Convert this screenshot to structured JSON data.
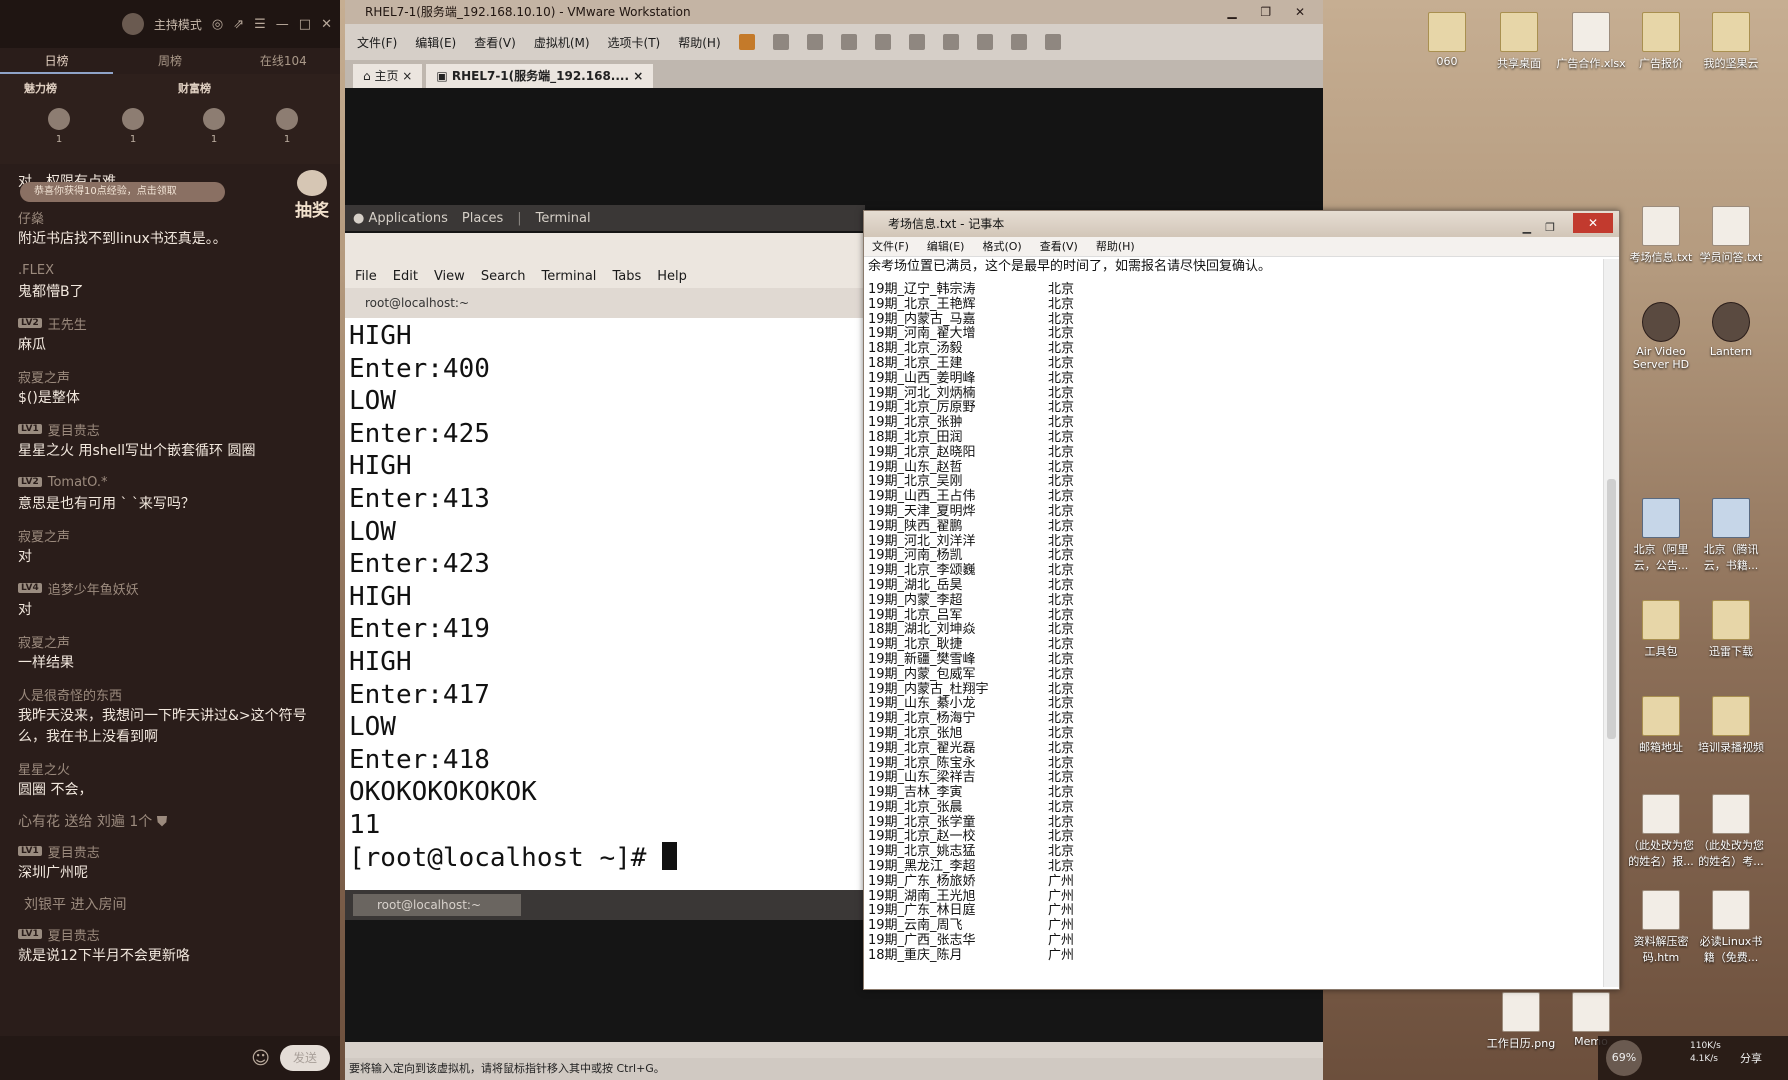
{
  "chat": {
    "mode_label": "主持模式",
    "tabs": [
      "日榜",
      "周榜",
      "在线104"
    ],
    "rank_titles": [
      "魅力榜",
      "财富榜"
    ],
    "rank_counts": [
      "1",
      "1",
      "1",
      "1"
    ],
    "pill_text": "恭喜你获得10点经验，点击领取",
    "lottery_label": "抽奖",
    "messages": [
      {
        "user": "",
        "lv": "",
        "text": "对，权限有点难"
      },
      {
        "user": "仔燊",
        "lv": "",
        "text": "附近书店找不到linux书还真是。。"
      },
      {
        "user": ".FLEX",
        "lv": "",
        "text": "鬼都懵B了"
      },
      {
        "user": "王先生",
        "lv": "LV2",
        "text": "麻瓜"
      },
      {
        "user": "寂夏之声",
        "lv": "",
        "text": "$()是整体"
      },
      {
        "user": "夏目贵志",
        "lv": "LV1",
        "text": "星星之火 用shell写出个嵌套循环 圆圈"
      },
      {
        "user": "TomatO.*",
        "lv": "LV2",
        "text": "意思是也有可用 ` `来写吗？"
      },
      {
        "user": "寂夏之声",
        "lv": "",
        "text": "对"
      },
      {
        "user": "追梦少年鱼妖妖",
        "lv": "LV4",
        "text": "对"
      },
      {
        "user": "寂夏之声",
        "lv": "",
        "text": "一样结果"
      },
      {
        "user": "人是很奇怪的东西",
        "lv": "",
        "text": "我昨天没来，我想问一下昨天讲过&>这个符号么，我在书上没看到啊"
      },
      {
        "user": "星星之火",
        "lv": "",
        "text": "圆圈 不会，"
      }
    ],
    "gift_line": "心有花 送给 刘遍 1个",
    "messages2": [
      {
        "user": "夏目贵志",
        "lv": "LV1",
        "text": "深圳广州呢"
      }
    ],
    "enter_line": "刘银平 进入房间",
    "messages3": [
      {
        "user": "夏目贵志",
        "lv": "LV1",
        "text": "就是说12下半月不会更新咯"
      }
    ],
    "send_label": "发送"
  },
  "vmware": {
    "title": "RHEL7-1(服务端_192.168.10.10) - VMware Workstation",
    "menu": [
      "文件(F)",
      "编辑(E)",
      "查看(V)",
      "虚拟机(M)",
      "选项卡(T)",
      "帮助(H)"
    ],
    "tabs": [
      "主页",
      "RHEL7-1(服务端_192.168...."
    ],
    "status_text": "要将输入定向到该虚拟机，请将鼠标指针移入其中或按 Ctrl+G。"
  },
  "gnome": {
    "applications": "Applications",
    "places": "Places",
    "terminal_app": "Terminal"
  },
  "terminal": {
    "menu": [
      "File",
      "Edit",
      "View",
      "Search",
      "Terminal",
      "Tabs",
      "Help"
    ],
    "tab_title": "root@localhost:~",
    "lines": [
      "HIGH",
      "Enter:400",
      "LOW",
      "Enter:425",
      "HIGH",
      "Enter:413",
      "LOW",
      "Enter:423",
      "HIGH",
      "Enter:419",
      "HIGH",
      "Enter:417",
      "LOW",
      "Enter:418",
      "OKOKOKOKOKOK",
      "11"
    ],
    "prompt": "[root@localhost ~]# ",
    "taskbar_item": "root@localhost:~"
  },
  "notepad": {
    "title": "考场信息.txt - 记事本",
    "menu": [
      "文件(F)",
      "编辑(E)",
      "格式(O)",
      "查看(V)",
      "帮助(H)"
    ],
    "header": "余考场位置已满员，这个是最早的时间了，如需报名请尽快回复确认。",
    "rows": [
      [
        "19期_辽宁_韩宗涛",
        "北京"
      ],
      [
        "19期_北京_王艳辉",
        "北京"
      ],
      [
        "19期_内蒙古_马嘉",
        "北京"
      ],
      [
        "19期_河南_翟大增",
        "北京"
      ],
      [
        "18期_北京_汤毅",
        "北京"
      ],
      [
        "18期_北京_王建",
        "北京"
      ],
      [
        "19期_山西_姜明峰",
        "北京"
      ],
      [
        "19期_河北_刘炳楠",
        "北京"
      ],
      [
        "19期_北京_厉原野",
        "北京"
      ],
      [
        "19期_北京_张翀",
        "北京"
      ],
      [
        "18期_北京_田润",
        "北京"
      ],
      [
        "19期_北京_赵晓阳",
        "北京"
      ],
      [
        "19期_山东_赵哲",
        "北京"
      ],
      [
        "19期_北京_吴刚",
        "北京"
      ],
      [
        "19期_山西_王占伟",
        "北京"
      ],
      [
        "19期_天津_夏明烨",
        "北京"
      ],
      [
        "19期_陕西_翟鹏",
        "北京"
      ],
      [
        "19期_河北_刘洋洋",
        "北京"
      ],
      [
        "19期_河南_杨凯",
        "北京"
      ],
      [
        "19期_北京_李颂巍",
        "北京"
      ],
      [
        "19期_湖北_岳昊",
        "北京"
      ],
      [
        "19期_内蒙_李超",
        "北京"
      ],
      [
        "19期_北京_吕军",
        "北京"
      ],
      [
        "18期_湖北_刘坤焱",
        "北京"
      ],
      [
        "19期_北京_耿捷",
        "北京"
      ],
      [
        "19期_新疆_樊雪峰",
        "北京"
      ],
      [
        "19期_内蒙_包威军",
        "北京"
      ],
      [
        "19期_内蒙古_杜翔宇",
        "北京"
      ],
      [
        "19期_山东_綦小龙",
        "北京"
      ],
      [
        "19期_北京_杨海宁",
        "北京"
      ],
      [
        "19期_北京_张旭",
        "北京"
      ],
      [
        "19期_北京_翟光磊",
        "北京"
      ],
      [
        "19期_北京_陈宝永",
        "北京"
      ],
      [
        "19期_山东_梁祥吉",
        "北京"
      ],
      [
        "19期_吉林_李寅",
        "北京"
      ],
      [
        "19期_北京_张晨",
        "北京"
      ],
      [
        "19期_北京_张学童",
        "北京"
      ],
      [
        "19期_北京_赵一校",
        "北京"
      ],
      [
        "19期_北京_姚志猛",
        "北京"
      ],
      [
        "19期_黑龙江_李超",
        "北京"
      ],
      [
        "19期_广东_杨旅娇",
        "广州"
      ],
      [
        "19期_湖南_王光旭",
        "广州"
      ],
      [
        "19期_广东_林日庭",
        "广州"
      ],
      [
        "19期_云南_周飞",
        "广州"
      ],
      [
        "19期_广西_张志华",
        "广州"
      ],
      [
        "18期_重庆_陈月",
        "广州"
      ]
    ]
  },
  "desktop": {
    "icons_top": [
      "060",
      "共享桌面",
      "广告合作.xlsx",
      "广告报价",
      "我的坚果云"
    ],
    "icons_right": [
      "考场信息.txt",
      "学员问答.txt",
      "Air Video Server HD",
      "Lantern",
      "北京（阿里云，公告...",
      "北京（腾讯云，书籍...",
      "工具包",
      "迅雷下载",
      "邮箱地址",
      "培训录播视频",
      "（此处改为您的姓名）报...",
      "（此处改为您的姓名）考...",
      "资料解压密码.htm",
      "必读Linux书籍（免费...",
      "工作日历.png",
      "Memo"
    ]
  },
  "tray": {
    "cpu": "69%",
    "up": "110K/s",
    "down": "4.1K/s",
    "share": "分享"
  }
}
